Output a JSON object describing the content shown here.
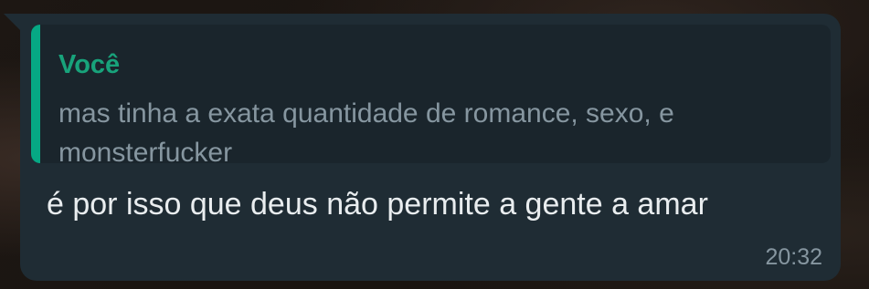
{
  "message": {
    "quoted": {
      "author": "Você",
      "text": "mas tinha a exata quantidade de romance, sexo, e monsterfucker"
    },
    "text": "é por isso que deus não permite a gente a amar",
    "time": "20:32"
  },
  "colors": {
    "bubble": "#1f2c34",
    "quote_background": "#1a252c",
    "quote_bar": "#06a884",
    "quote_author": "#18a37b",
    "secondary_text": "#8696a0",
    "primary_text": "#e9edef"
  }
}
